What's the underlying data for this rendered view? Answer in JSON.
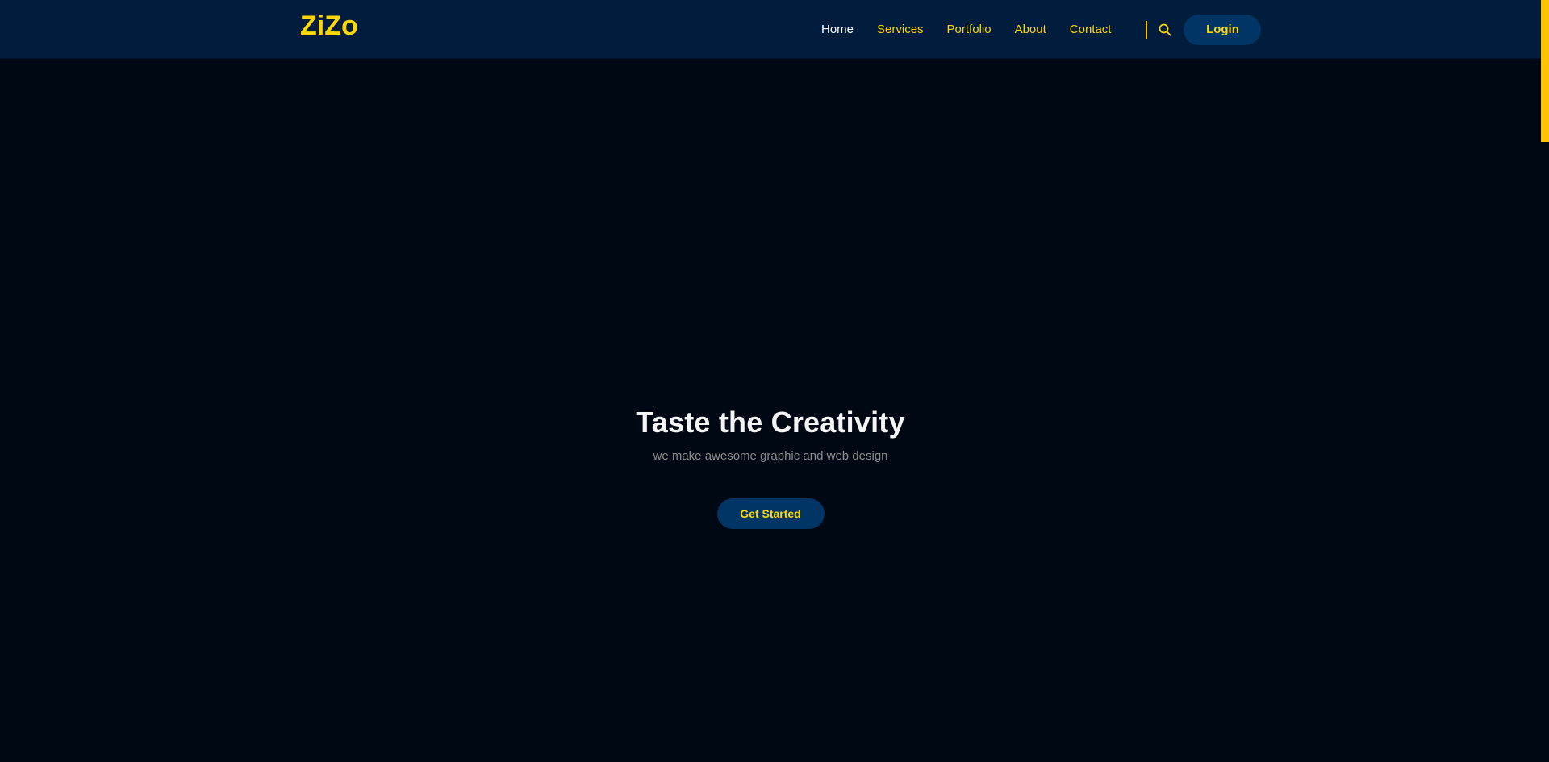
{
  "brand": {
    "logo_text": "ZiZo"
  },
  "nav": {
    "items": [
      {
        "label": "Home",
        "active": true
      },
      {
        "label": "Services",
        "active": false
      },
      {
        "label": "Portfolio",
        "active": false
      },
      {
        "label": "About",
        "active": false
      },
      {
        "label": "Contact",
        "active": false
      }
    ],
    "search_icon": "search-icon",
    "login_label": "Login"
  },
  "hero": {
    "title": "Taste the Creativity",
    "subtitle": "we make awesome graphic and web design",
    "cta_label": "Get Started"
  },
  "colors": {
    "header_bg": "#001d3d",
    "page_bg": "#000814",
    "accent": "#ffd60a",
    "button_bg": "#003566",
    "progress_accent": "#ff7a00"
  },
  "page_load_progress": 0.2
}
